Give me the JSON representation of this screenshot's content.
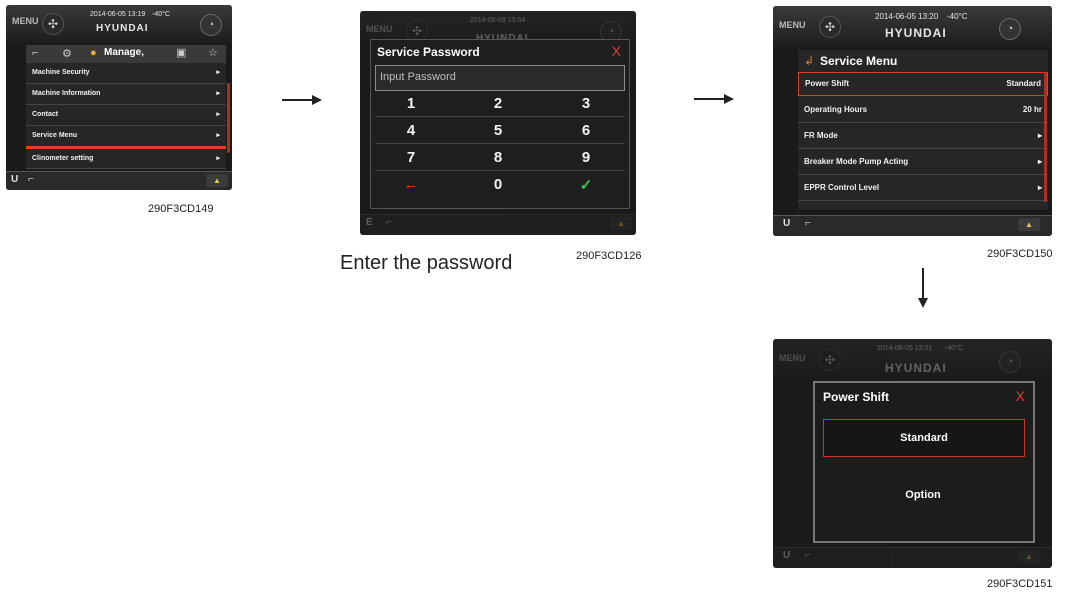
{
  "screen1": {
    "menu_label": "MENU",
    "datetime": "2014-06-05 13:19",
    "temp": "-40°C",
    "brand": "HYUNDAI",
    "tab_title": "Manage,",
    "items": [
      "Machine Security",
      "Machine Information",
      "Contact",
      "Service Menu",
      "Clinometer setting"
    ],
    "chevron": "▸",
    "mode_letter": "U",
    "caption": "290F3CD149"
  },
  "screen2": {
    "menu_label": "MENU",
    "datetime": "2014-06-09 13:54",
    "brand": "HYUNDAI",
    "dialog_title": "Service Password",
    "close": "X",
    "input_placeholder": "Input Password",
    "keys": [
      "1",
      "2",
      "3",
      "4",
      "5",
      "6",
      "7",
      "8",
      "9",
      "←",
      "0",
      "✓"
    ],
    "mode_letter": "E",
    "caption": "Enter the password",
    "code": "290F3CD126"
  },
  "screen3": {
    "menu_label": "MENU",
    "datetime": "2014-06-05 13:20",
    "temp": "-40°C",
    "brand": "HYUNDAI",
    "title": "Service Menu",
    "rows": [
      {
        "label": "Power Shift",
        "value": "Standard"
      },
      {
        "label": "Operating Hours",
        "value": "20 hr"
      },
      {
        "label": "FR Mode",
        "value": "▸"
      },
      {
        "label": "Breaker Mode Pump Acting",
        "value": "▸"
      },
      {
        "label": "EPPR Control Level",
        "value": "▸"
      }
    ],
    "mode_letter": "U",
    "caption": "290F3CD150"
  },
  "screen4": {
    "menu_label": "MENU",
    "datetime": "2014-06-05 13:21",
    "temp": "-40°C",
    "brand": "HYUNDAI",
    "dialog_title": "Power Shift",
    "close": "X",
    "options": [
      "Standard",
      "Option"
    ],
    "mode_letter": "U",
    "caption": "290F3CD151"
  },
  "colors": {
    "accent_red": "#e0402a",
    "check_green": "#3cc060",
    "screen_bg": "#1a1a1a"
  }
}
